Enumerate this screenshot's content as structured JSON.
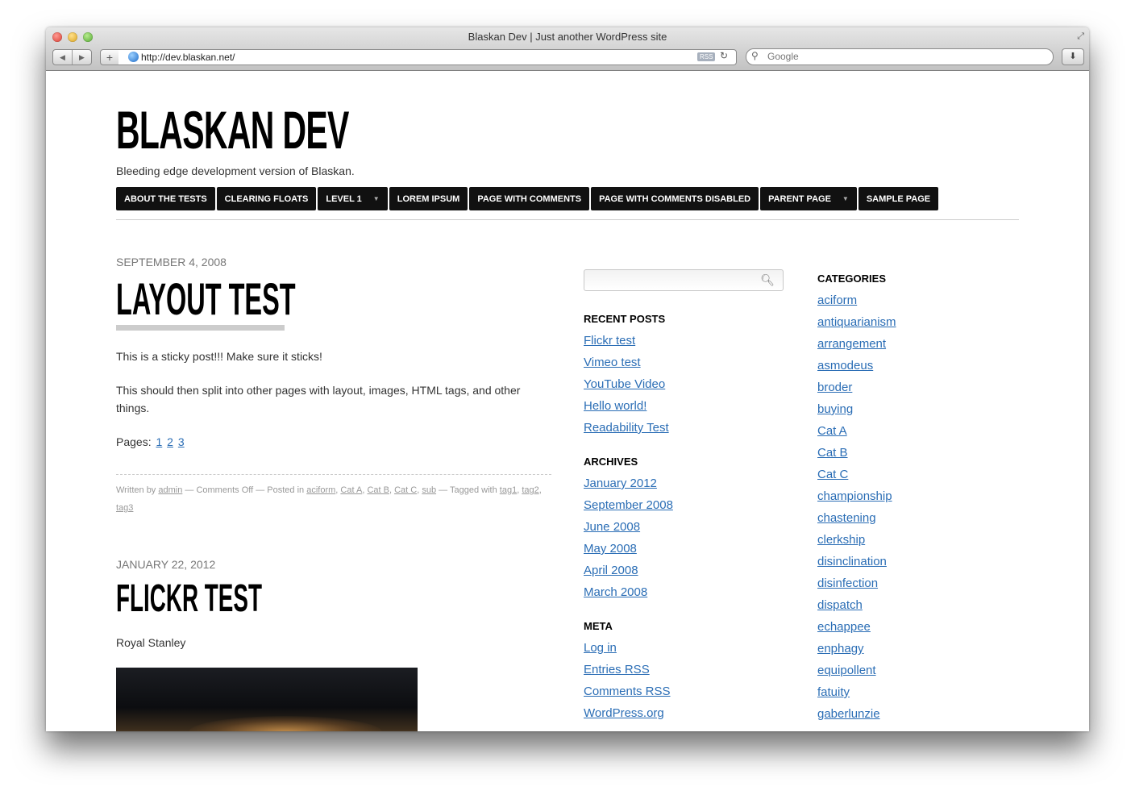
{
  "browser": {
    "window_title": "Blaskan Dev | Just another WordPress site",
    "url": "http://dev.blaskan.net/",
    "rss_badge": "RSS",
    "search_placeholder": "Google"
  },
  "site": {
    "title": "BLASKAN DEV",
    "tagline": "Bleeding edge development version of Blaskan."
  },
  "menu": [
    {
      "label": "ABOUT THE TESTS",
      "dropdown": false
    },
    {
      "label": "CLEARING FLOATS",
      "dropdown": false
    },
    {
      "label": "LEVEL 1",
      "dropdown": true
    },
    {
      "label": "LOREM IPSUM",
      "dropdown": false
    },
    {
      "label": "PAGE WITH COMMENTS",
      "dropdown": false
    },
    {
      "label": "PAGE WITH COMMENTS DISABLED",
      "dropdown": false
    },
    {
      "label": "PARENT PAGE",
      "dropdown": true
    },
    {
      "label": "SAMPLE PAGE",
      "dropdown": false
    }
  ],
  "posts": [
    {
      "date": "SEPTEMBER 4, 2008",
      "title": "LAYOUT TEST",
      "p1": "This is a sticky post!!! Make sure it sticks!",
      "p2": "This should then split into other pages with layout, images, HTML tags, and other things.",
      "pages_label": "Pages:",
      "pages": [
        "1",
        "2",
        "3"
      ],
      "meta": {
        "written_by": "Written by",
        "author": "admin",
        "comments": "— Comments Off — Posted in",
        "categories": [
          "aciform",
          "Cat A",
          "Cat B",
          "Cat C",
          "sub"
        ],
        "tagged": "— Tagged with",
        "tags": [
          "tag1",
          "tag2",
          "tag3"
        ]
      }
    },
    {
      "date": "JANUARY 22, 2012",
      "title": "FLICKR TEST",
      "p1": "Royal Stanley"
    }
  ],
  "sidebar": {
    "recent_posts": {
      "title": "RECENT POSTS",
      "items": [
        "Flickr test",
        "Vimeo test",
        "YouTube Video",
        "Hello world!",
        "Readability Test"
      ]
    },
    "archives": {
      "title": "ARCHIVES",
      "items": [
        "January 2012",
        "September 2008",
        "June 2008",
        "May 2008",
        "April 2008",
        "March 2008"
      ]
    },
    "meta": {
      "title": "META",
      "items": [
        "Log in",
        "Entries RSS",
        "Comments RSS",
        "WordPress.org"
      ]
    },
    "categories": {
      "title": "CATEGORIES",
      "items": [
        "aciform",
        "antiquarianism",
        "arrangement",
        "asmodeus",
        "broder",
        "buying",
        "Cat A",
        "Cat B",
        "Cat C",
        "championship",
        "chastening",
        "clerkship",
        "disinclination",
        "disinfection",
        "dispatch",
        "echappee",
        "enphagy",
        "equipollent",
        "fatuity",
        "gaberlunzie"
      ]
    }
  },
  "colors": {
    "link": "#2a6db5",
    "menu_bg": "#111111",
    "title_underline": "#cccccc"
  }
}
